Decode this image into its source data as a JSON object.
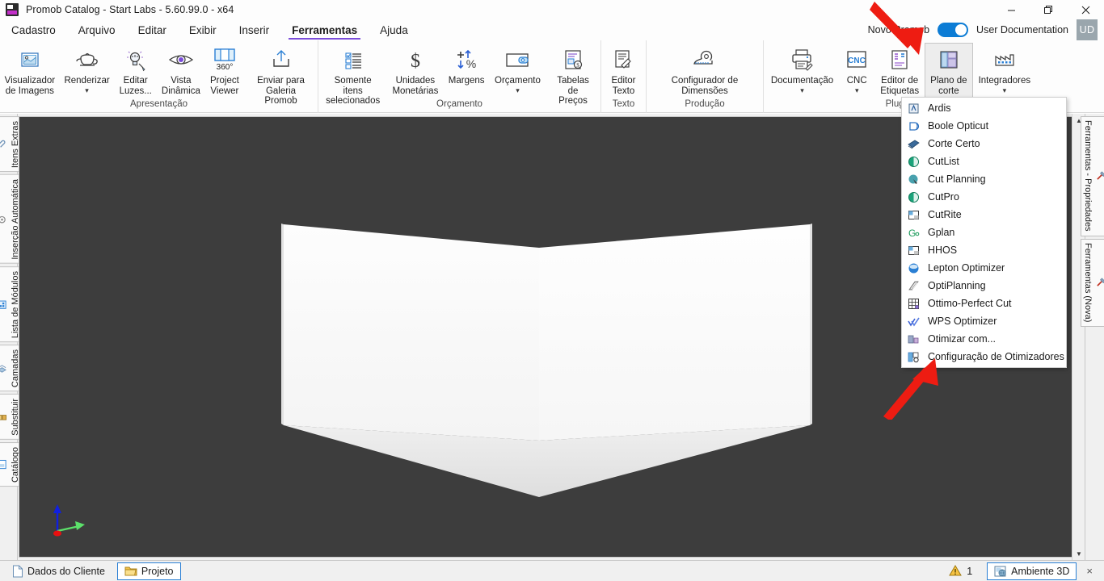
{
  "window": {
    "title": "Promob Catalog - Start Labs - 5.60.99.0 - x64",
    "logo_name": "promob-logo",
    "controls": {
      "minimize": "minimize",
      "restore": "restore",
      "close": "close"
    }
  },
  "menubar": {
    "items": [
      {
        "label": "Cadastro",
        "active": false
      },
      {
        "label": "Arquivo",
        "active": false
      },
      {
        "label": "Editar",
        "active": false
      },
      {
        "label": "Exibir",
        "active": false
      },
      {
        "label": "Inserir",
        "active": false
      },
      {
        "label": "Ferramentas",
        "active": true
      },
      {
        "label": "Ajuda",
        "active": false
      }
    ],
    "right": {
      "toggle_label": "Novo Promob",
      "toggle_on": true,
      "user_label": "User Documentation",
      "avatar_initials": "UD"
    }
  },
  "ribbon": {
    "groups": [
      {
        "label": "Apresentação",
        "items": [
          {
            "label": "Visualizador\nde Imagens",
            "icon": "image-viewer-icon",
            "caret": false
          },
          {
            "label": "Renderizar",
            "icon": "teapot-render-icon",
            "caret": true
          },
          {
            "label": "Editar\nLuzes...",
            "icon": "edit-lights-icon",
            "caret": false
          },
          {
            "label": "Vista\nDinâmica",
            "icon": "dynamic-view-eye-icon",
            "caret": false
          },
          {
            "label": "Project\nViewer",
            "icon": "project-viewer-360-icon",
            "caret": false
          },
          {
            "label": "Enviar para\nGaleria Promob",
            "icon": "upload-gallery-icon",
            "caret": false
          }
        ]
      },
      {
        "label": "Orçamento",
        "items": [
          {
            "label": "Somente itens\nselecionados",
            "icon": "checklist-icon",
            "caret": false
          },
          {
            "label": "Unidades\nMonetárias",
            "icon": "currency-icon",
            "caret": false
          },
          {
            "label": "Margens",
            "icon": "margins-percent-icon",
            "caret": false
          },
          {
            "label": "Orçamento",
            "icon": "wallet-icon",
            "caret": true
          },
          {
            "label": "Tabelas de\nPreços",
            "icon": "price-tables-icon",
            "caret": false
          }
        ]
      },
      {
        "label": "Texto",
        "items": [
          {
            "label": "Editor\nTexto",
            "icon": "text-editor-icon",
            "caret": false
          }
        ]
      },
      {
        "label": "Produção",
        "items": [
          {
            "label": "Configurador de\nDimensões",
            "icon": "dimension-tape-icon",
            "caret": false
          }
        ]
      },
      {
        "label": "Plugins",
        "items": [
          {
            "label": "Documentação",
            "icon": "printer-docs-icon",
            "caret": true
          },
          {
            "label": "CNC",
            "icon": "cnc-icon",
            "caret": true
          },
          {
            "label": "Editor de\nEtiquetas",
            "icon": "label-editor-icon",
            "caret": false
          },
          {
            "label": "Plano de\ncorte",
            "icon": "cut-plan-icon",
            "caret": true,
            "selected": true
          },
          {
            "label": "Integradores",
            "icon": "factory-icon",
            "caret": true
          }
        ]
      }
    ]
  },
  "dropdown": {
    "name": "plano-de-corte-menu",
    "items": [
      {
        "label": "Ardis",
        "icon": "ardis-icon"
      },
      {
        "label": "Boole Opticut",
        "icon": "boole-opticut-icon"
      },
      {
        "label": "Corte Certo",
        "icon": "corte-certo-icon"
      },
      {
        "label": "CutList",
        "icon": "cutlist-icon"
      },
      {
        "label": "Cut Planning",
        "icon": "cut-planning-icon"
      },
      {
        "label": "CutPro",
        "icon": "cutpro-icon"
      },
      {
        "label": "CutRite",
        "icon": "cutrite-icon"
      },
      {
        "label": "Gplan",
        "icon": "gplan-icon"
      },
      {
        "label": "HHOS",
        "icon": "hhos-icon"
      },
      {
        "label": "Lepton Optimizer",
        "icon": "lepton-optimizer-icon"
      },
      {
        "label": "OptiPlanning",
        "icon": "optiplanning-icon"
      },
      {
        "label": "Ottimo-Perfect Cut",
        "icon": "ottimo-perfect-cut-icon"
      },
      {
        "label": "WPS Optimizer",
        "icon": "wps-optimizer-icon"
      },
      {
        "label": "Otimizar com...",
        "icon": "otimizar-com-icon"
      },
      {
        "label": "Configuração de Otimizadores",
        "icon": "configuracao-otimizadores-icon"
      }
    ]
  },
  "sidebar_left": {
    "items": [
      {
        "label": "Itens Extras",
        "icon": "clip-icon"
      },
      {
        "label": "Inserção Automática",
        "icon": "auto-insert-icon"
      },
      {
        "label": "Lista de Módulos",
        "icon": "modules-list-icon"
      },
      {
        "label": "Camadas",
        "icon": "layers-icon"
      },
      {
        "label": "Substituir",
        "icon": "replace-icon"
      },
      {
        "label": "Catálogo",
        "icon": "catalog-icon"
      }
    ]
  },
  "sidebar_right": {
    "items": [
      {
        "label": "Ferramentas - Propriedades",
        "icon": "tools-properties-icon"
      },
      {
        "label": "Ferramentas (Nova)",
        "icon": "tools-new-icon"
      }
    ]
  },
  "viewport": {
    "name": "3d-viewport",
    "background_color": "#3d3d3d",
    "axis_gizmo": {
      "name": "axis-gizmo",
      "z_color": "#1020e0",
      "y_color": "#5ce06a",
      "x_color": "#e81010"
    }
  },
  "statusbar": {
    "tabs": [
      {
        "label": "Dados do Cliente",
        "icon": "document-icon",
        "selected": false
      },
      {
        "label": "Projeto",
        "icon": "folder-icon",
        "selected": true
      }
    ],
    "warning_count": "1",
    "view_tab": {
      "label": "Ambiente 3D",
      "icon": "ambiente-3d-icon",
      "selected": true,
      "close": "×"
    }
  },
  "annotations": {
    "arrow_top": "red-arrow-pointing-plano-de-corte",
    "arrow_bottom": "red-arrow-pointing-configuracao-de-otimizadores",
    "color": "#ee1c12"
  }
}
